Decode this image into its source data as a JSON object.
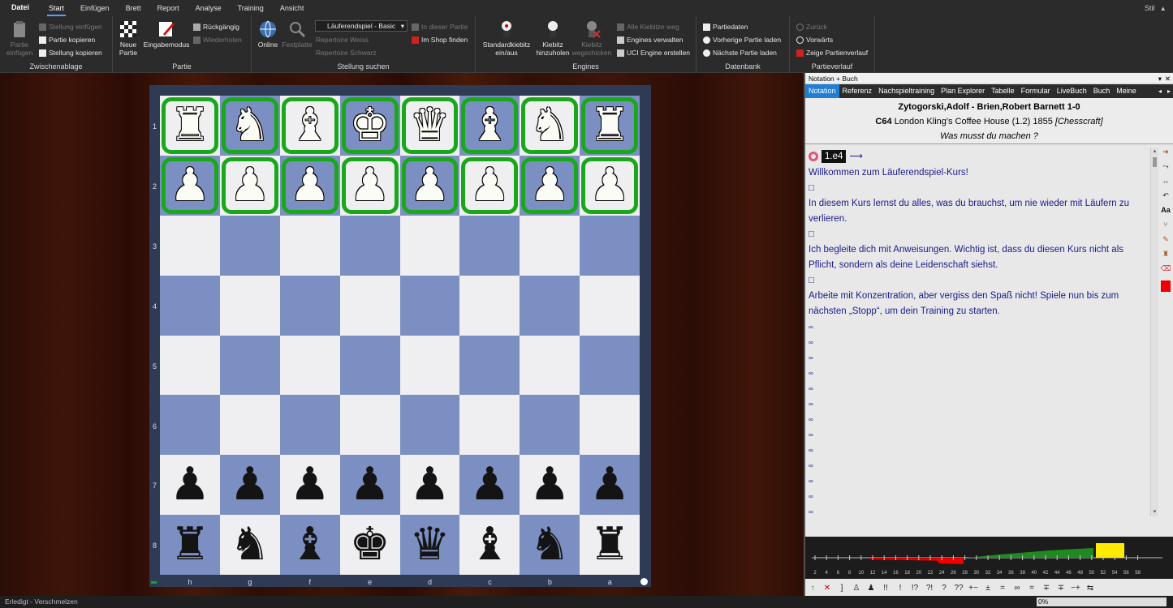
{
  "menu": {
    "file": "Datei",
    "tabs": [
      "Start",
      "Einfügen",
      "Brett",
      "Report",
      "Analyse",
      "Training",
      "Ansicht"
    ],
    "active": "Start",
    "style": "Stil"
  },
  "ribbon": {
    "clipboard": {
      "paste": "Partie einfügen",
      "paste_pos": "Stellung einfügen",
      "copy_game": "Partie kopieren",
      "copy_pos": "Stellung kopieren",
      "label": "Zwischenablage"
    },
    "game": {
      "new": "Neue Partie",
      "input": "Eingabemodus",
      "undo": "Rückgängig",
      "redo": "Wiederholen",
      "label": "Partie"
    },
    "search": {
      "online": "Online",
      "disk": "Festplatte",
      "combo": "Läuferendspiel - Basic",
      "in_game": "In dieser Partie",
      "rep_white": "Repertoire Weiss",
      "shop": "Im Shop finden",
      "rep_black": "Repertoire Schwarz",
      "label": "Stellung suchen"
    },
    "engines": {
      "std": "Standardkiebitz ein/aus",
      "add": "Kiebitz hinzuholen",
      "remove": "Kiebitz wegschicken",
      "all_off": "Alle Kiebitze weg",
      "manage": "Engines verwalten",
      "uci": "UCI Engine erstellen",
      "label": "Engines"
    },
    "db": {
      "data": "Partiedaten",
      "prev": "Vorherige Partie laden",
      "next": "Nächste Partie laden",
      "label": "Datenbank"
    },
    "history": {
      "back": "Zurück",
      "fwd": "Vorwärts",
      "show": "Zeige Partienverlauf",
      "label": "Partieverlauf"
    }
  },
  "board": {
    "ranks": [
      "1",
      "2",
      "3",
      "4",
      "5",
      "6",
      "7",
      "8"
    ],
    "files": [
      "h",
      "g",
      "f",
      "e",
      "d",
      "c",
      "b",
      "a"
    ],
    "rows": [
      [
        "♜",
        "♞",
        "♝",
        "♚",
        "♛",
        "♝",
        "♞",
        "♜"
      ],
      [
        "♟",
        "♟",
        "♟",
        "♟",
        "♟",
        "♟",
        "♟",
        "♟"
      ],
      [
        "",
        "",
        "",
        "",
        "",
        "",
        "",
        ""
      ],
      [
        "",
        "",
        "",
        "",
        "",
        "",
        "",
        ""
      ],
      [
        "",
        "",
        "",
        "",
        "",
        "",
        "",
        ""
      ],
      [
        "",
        "",
        "",
        "",
        "",
        "",
        "",
        ""
      ],
      [
        "♟",
        "♟",
        "♟",
        "♟",
        "♟",
        "♟",
        "♟",
        "♟"
      ],
      [
        "♜",
        "♞",
        "♝",
        "♚",
        "♛",
        "♝",
        "♞",
        "♜"
      ]
    ],
    "colors": [
      "w",
      "w",
      "",
      "",
      "",
      "",
      "b",
      "b"
    ]
  },
  "notation": {
    "title": "Notation + Buch",
    "tabs": [
      "Notation",
      "Referenz",
      "Nachspieltraining",
      "Plan Explorer",
      "Tabelle",
      "Formular",
      "LiveBuch",
      "Buch",
      "Meine"
    ],
    "players": "Zytogorski,Adolf - Brien,Robert Barnett  1-0",
    "eco": "C64",
    "event": "London Kling's Coffee House (1.2) 1855",
    "source": "[Chesscraft]",
    "prompt": "Was musst du machen ?",
    "move": "1.e4",
    "lines": [
      "Willkommen zum Läuferendspiel-Kurs!",
      "□",
      "In diesem Kurs lernst du alles, was du brauchst, um nie wieder mit Läufern zu verlieren.",
      "□",
      "Ich begleite dich mit Anweisungen. Wichtig ist, dass du diesen Kurs nicht als Pflicht, sondern als deine Leidenschaft siehst.",
      "□",
      "Arbeite mit Konzentration, aber vergiss den Spaß nicht! Spiele nun bis zum nächsten „Stopp“, um dein Training zu starten."
    ],
    "graph_ticks": [
      "2",
      "4",
      "6",
      "8",
      "10",
      "12",
      "14",
      "16",
      "18",
      "20",
      "22",
      "24",
      "26",
      "28",
      "30",
      "32",
      "34",
      "36",
      "38",
      "40",
      "42",
      "44",
      "46",
      "48",
      "50",
      "52",
      "54",
      "56",
      "58"
    ],
    "symbols": [
      "↑",
      "✕",
      "]",
      "♙",
      "♟",
      "!!",
      "!",
      "!?",
      "?!",
      "?",
      "??",
      "+−",
      "±",
      "=",
      "∞",
      "=",
      "∓",
      "∓",
      "−+",
      "⇆"
    ]
  },
  "status": {
    "left": "Erledigt - Verschmelzen",
    "zoom": "0%"
  }
}
